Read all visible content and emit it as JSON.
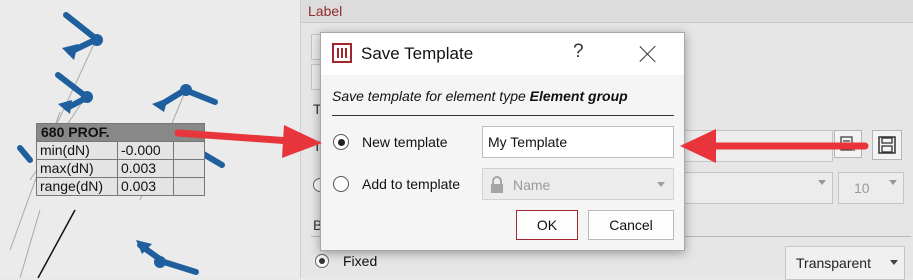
{
  "canvas": {
    "result_table": {
      "title": "680 PROF.",
      "rows": [
        {
          "label": "min(dN)",
          "value": "-0.000"
        },
        {
          "label": "max(dN)",
          "value": "0.003"
        },
        {
          "label": "range(dN)",
          "value": "0.003"
        }
      ]
    }
  },
  "panel": {
    "section_label": "Label",
    "frag_te": "Te",
    "frag_te2": "Te",
    "frag_b": "B",
    "fixed_label": "Fixed",
    "background_value": "Transparent",
    "size_value": "10"
  },
  "dialog": {
    "title": "Save Template",
    "help": "?",
    "subtitle_prefix": "Save template for element type ",
    "subtitle_type": "Element group",
    "new_template_label": "New template",
    "new_template_value": "My Template",
    "add_to_template_label": "Add to template",
    "add_to_template_placeholder": "Name",
    "ok_label": "OK",
    "cancel_label": "Cancel"
  },
  "colors": {
    "accent": "#a0272d",
    "annotation_arrow": "#e8353b",
    "model_blue": "#1f5f9e"
  }
}
